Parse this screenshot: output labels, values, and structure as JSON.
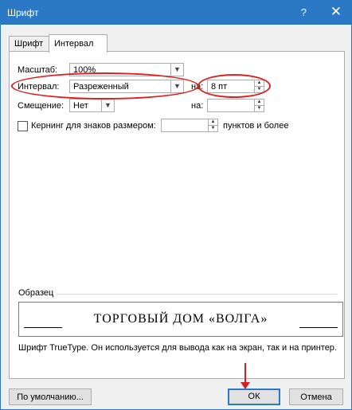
{
  "window": {
    "title": "Шрифт",
    "help": "?",
    "close": "✕"
  },
  "tabs": [
    {
      "label": "Шрифт"
    },
    {
      "label": "Интервал"
    }
  ],
  "fields": {
    "scale": {
      "label": "Масштаб:",
      "value": "100%"
    },
    "spacing": {
      "label": "Интервал:",
      "value": "Разреженный",
      "by_label": "на:",
      "by_value": "8 пт"
    },
    "position": {
      "label": "Смещение:",
      "value": "Нет",
      "by_label": "на:",
      "by_value": ""
    },
    "kerning": {
      "label": "Кернинг для знаков размером:",
      "value": "",
      "suffix": "пунктов и более",
      "checked": false
    }
  },
  "preview": {
    "label": "Образец",
    "sample": "ТОРГОВЫЙ ДОМ «ВОЛГА»",
    "info": "Шрифт TrueType. Он используется для вывода как на экран, так и на принтер."
  },
  "buttons": {
    "default": "По умолчанию...",
    "ok": "ОК",
    "cancel": "Отмена"
  },
  "colors": {
    "titlebar": "#2b78c4",
    "annotation": "#e02020"
  }
}
